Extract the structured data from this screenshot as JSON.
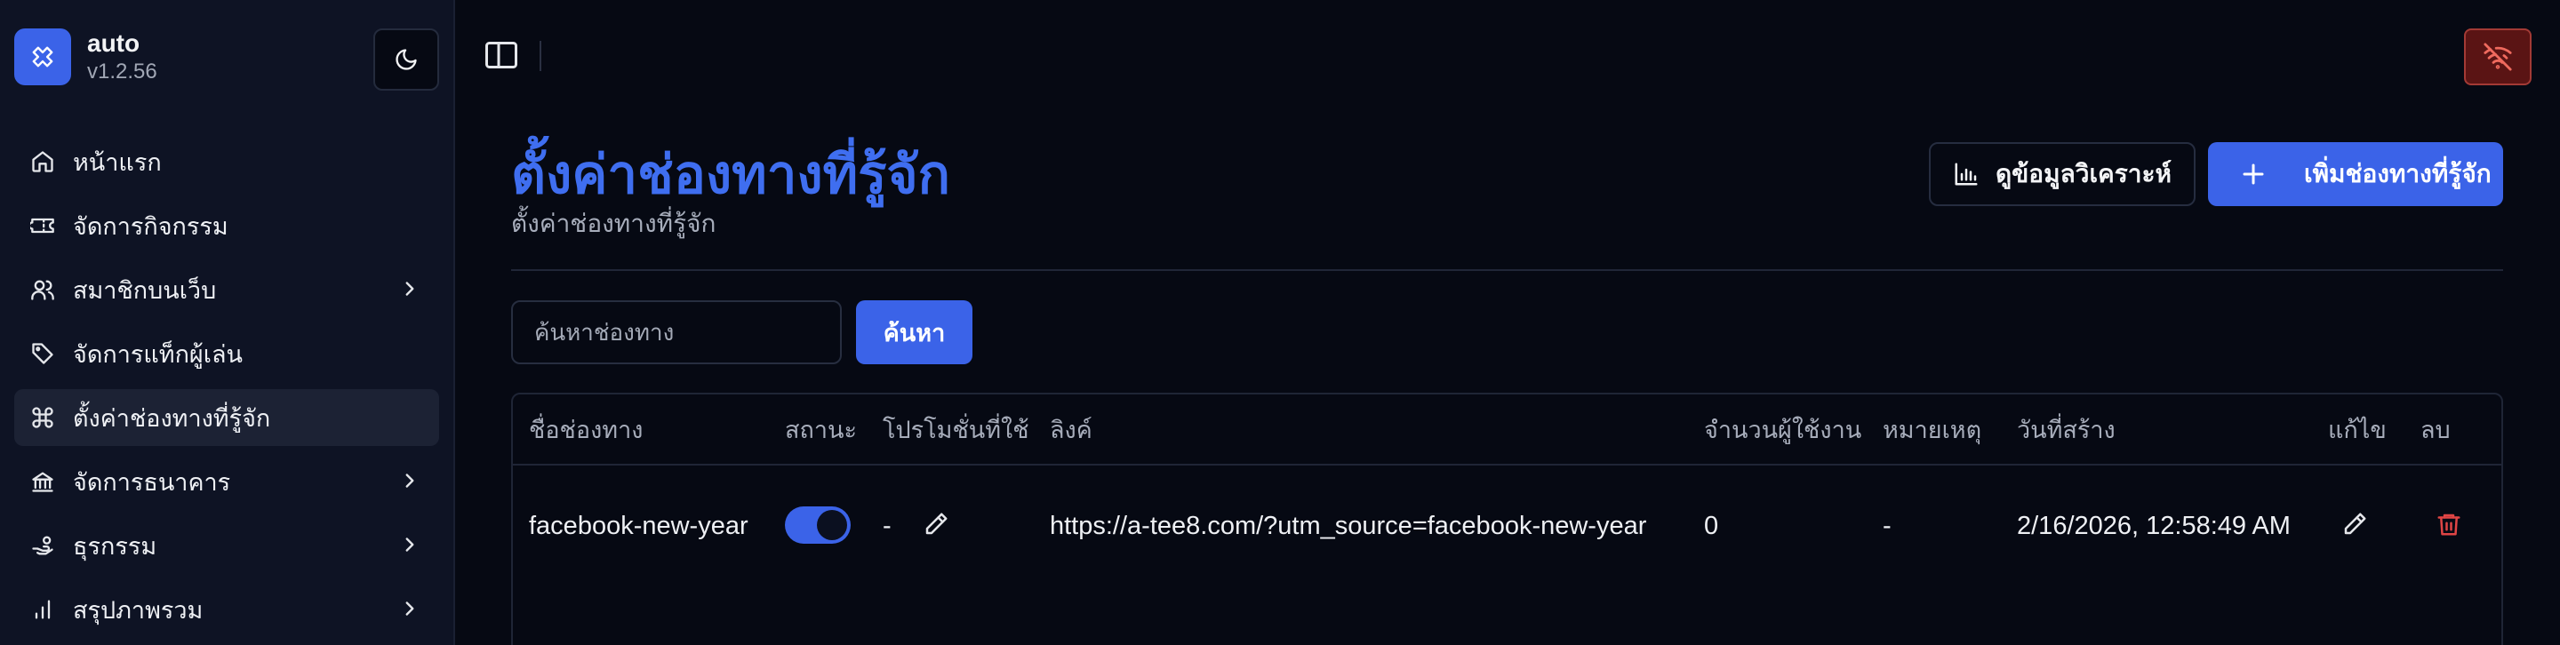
{
  "app": {
    "name": "auto",
    "version": "v1.2.56"
  },
  "sidebar": {
    "items": [
      {
        "label": "หน้าแรก",
        "icon": "home-icon",
        "active": false,
        "has_children": false
      },
      {
        "label": "จัดการกิจกรรม",
        "icon": "ticket-icon",
        "active": false,
        "has_children": false
      },
      {
        "label": "สมาชิกบนเว็บ",
        "icon": "users-icon",
        "active": false,
        "has_children": true
      },
      {
        "label": "จัดการแท็กผู้เล่น",
        "icon": "tag-icon",
        "active": false,
        "has_children": false
      },
      {
        "label": "ตั้งค่าช่องทางที่รู้จัก",
        "icon": "command-icon",
        "active": true,
        "has_children": false
      },
      {
        "label": "จัดการธนาคาร",
        "icon": "bank-icon",
        "active": false,
        "has_children": true
      },
      {
        "label": "ธุรกรรม",
        "icon": "hand-coins-icon",
        "active": false,
        "has_children": true
      },
      {
        "label": "สรุปภาพรวม",
        "icon": "bar-chart-icon",
        "active": false,
        "has_children": true
      }
    ]
  },
  "page": {
    "title": "ตั้งค่าช่องทางที่รู้จัก",
    "subtitle": "ตั้งค่าช่องทางที่รู้จัก",
    "analytics_button": "ดูข้อมูลวิเคราะห์",
    "add_button": "เพิ่มช่องทางที่รู้จัก"
  },
  "search": {
    "placeholder": "ค้นหาช่องทาง",
    "value": "",
    "button": "ค้นหา"
  },
  "table": {
    "headers": {
      "name": "ชื่อช่องทาง",
      "status": "สถานะ",
      "promotion": "โปรโมชั่นที่ใช้",
      "link": "ลิงค์",
      "users": "จำนวนผู้ใช้งาน",
      "note": "หมายเหตุ",
      "created": "วันที่สร้าง",
      "edit": "แก้ไข",
      "delete": "ลบ"
    },
    "rows": [
      {
        "name": "facebook-new-year",
        "status_on": true,
        "promotion": "-",
        "link": "https://a-tee8.com/?utm_source=facebook-new-year",
        "users": "0",
        "note": "-",
        "created": "2/16/2026, 12:58:49 AM"
      }
    ]
  },
  "colors": {
    "accent": "#3b63e8",
    "danger": "#e04545",
    "background": "#060913",
    "sidebar": "#0e1324"
  }
}
